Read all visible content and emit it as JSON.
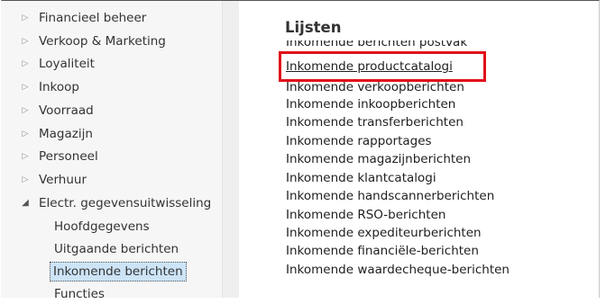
{
  "sidebar": {
    "items": [
      {
        "label": "Financieel beheer"
      },
      {
        "label": "Verkoop & Marketing"
      },
      {
        "label": "Loyaliteit"
      },
      {
        "label": "Inkoop"
      },
      {
        "label": "Voorraad"
      },
      {
        "label": "Magazijn"
      },
      {
        "label": "Personeel"
      },
      {
        "label": "Verhuur"
      },
      {
        "label": "Electr. gegevensuitwisseling"
      }
    ],
    "children": [
      {
        "label": "Hoofdgegevens"
      },
      {
        "label": "Uitgaande berichten"
      },
      {
        "label": "Inkomende berichten"
      },
      {
        "label": "Functies"
      }
    ],
    "selected": "Inkomende berichten"
  },
  "content": {
    "heading": "Lijsten",
    "links": [
      {
        "label": "Inkomende berichten postvak"
      },
      {
        "label": "Inkomende productcatalogi"
      },
      {
        "label": "Inkomende verkoopberichten"
      },
      {
        "label": "Inkomende inkoopberichten"
      },
      {
        "label": "Inkomende transferberichten"
      },
      {
        "label": "Inkomende rapportages"
      },
      {
        "label": "Inkomende magazijnberichten"
      },
      {
        "label": "Inkomende klantcatalogi"
      },
      {
        "label": "Inkomende handscannerberichten"
      },
      {
        "label": "Inkomende RSO-berichten"
      },
      {
        "label": "Inkomende expediteurberichten"
      },
      {
        "label": "Inkomende financiële-berichten"
      },
      {
        "label": "Inkomende waardecheque-berichten"
      }
    ],
    "highlighted_link": "Inkomende productcatalogi"
  },
  "colors": {
    "highlight_box": "#e10f1a",
    "selection_bg": "#cde4f7"
  }
}
